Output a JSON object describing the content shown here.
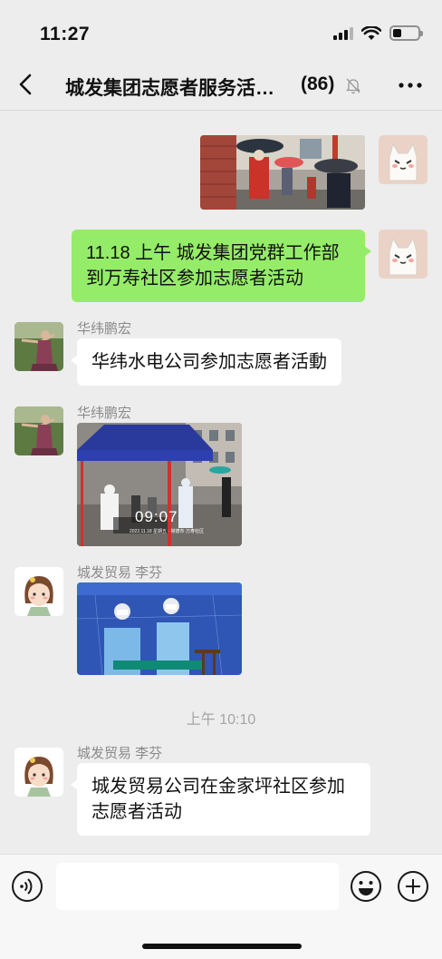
{
  "status_bar": {
    "time": "11:27",
    "battery_level": 0.35
  },
  "header": {
    "title": "城发集团志愿者服务活…",
    "member_count": "(86)",
    "icons": [
      "back-chevron-icon",
      "mute-bell-icon",
      "more-dots-icon"
    ]
  },
  "messages": [
    {
      "side": "right",
      "type": "image",
      "subject": "street scene with umbrellas and volunteers"
    },
    {
      "side": "right",
      "type": "text",
      "text": "11.18 上午  城发集团党群工作部到万寿社区参加志愿者活动"
    },
    {
      "side": "left",
      "type": "text",
      "sender": "华纬鹏宏",
      "text": "华纬水电公司参加志愿者活動"
    },
    {
      "side": "left",
      "type": "image",
      "sender": "华纬鹏宏",
      "subject": "blue tent testing site",
      "overlay_time": "09:07",
      "overlay_caption": "2022.11.18  星期五 · 常德市·万寿社区"
    },
    {
      "side": "left",
      "type": "image",
      "sender": "城发贸易   李芬",
      "subject": "two volunteers in protective suits under blue tent"
    },
    {
      "type": "timestamp",
      "text": "上午 10:10"
    },
    {
      "side": "left",
      "type": "text",
      "sender": "城发贸易   李芬",
      "text": "城发贸易公司在金家坪社区参加志愿者活动"
    }
  ],
  "input_bar": {
    "placeholder": "",
    "icons": [
      "voice-icon",
      "emoji-icon",
      "plus-icon"
    ]
  },
  "colors": {
    "background": "#ededed",
    "sent_bubble": "#95ec69",
    "received_bubble": "#ffffff",
    "sender_name": "#8a8a8a"
  }
}
